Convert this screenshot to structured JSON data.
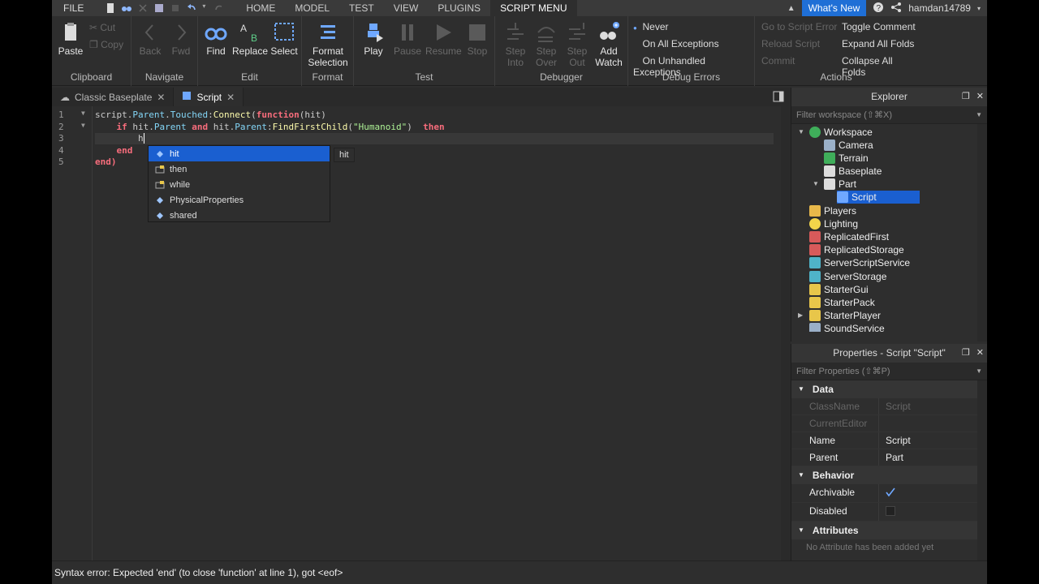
{
  "menubar": {
    "file": "FILE",
    "tabs": [
      "HOME",
      "MODEL",
      "TEST",
      "VIEW",
      "PLUGINS",
      "SCRIPT MENU"
    ],
    "whats_new": "What's New",
    "username": "hamdan14789"
  },
  "ribbon": {
    "clipboard": {
      "label": "Clipboard",
      "paste": "Paste",
      "cut": "Cut",
      "copy": "Copy"
    },
    "navigate": {
      "label": "Navigate",
      "back": "Back",
      "fwd": "Fwd"
    },
    "edit": {
      "label": "Edit",
      "find": "Find",
      "replace": "Replace",
      "select": "Select"
    },
    "format": {
      "label": "Format",
      "format_selection_line1": "Format",
      "format_selection_line2": "Selection"
    },
    "test": {
      "label": "Test",
      "play": "Play",
      "pause": "Pause",
      "resume": "Resume",
      "stop": "Stop"
    },
    "debugger": {
      "label": "Debugger",
      "step_into_1": "Step",
      "step_into_2": "Into",
      "step_over_1": "Step",
      "step_over_2": "Over",
      "step_out_1": "Step",
      "step_out_2": "Out",
      "add_watch_1": "Add",
      "add_watch_2": "Watch"
    },
    "debug_errors": {
      "label": "Debug Errors",
      "never": "Never",
      "all": "On All Exceptions",
      "unhandled": "On Unhandled Exceptions"
    },
    "actions": {
      "label": "Actions",
      "goto_error": "Go to Script Error",
      "reload": "Reload Script",
      "commit": "Commit",
      "toggle_comment": "Toggle Comment",
      "expand_folds": "Expand All Folds",
      "collapse_folds": "Collapse All Folds"
    }
  },
  "doctabs": [
    {
      "label": "Classic Baseplate"
    },
    {
      "label": "Script"
    }
  ],
  "editor": {
    "line_numbers": [
      "1",
      "2",
      "3",
      "4",
      "5"
    ],
    "line1": {
      "a": "script",
      "b": ".",
      "c": "Parent",
      "d": ".",
      "e": "Touched",
      "f": ":",
      "g": "Connect",
      "h": "(",
      "i": "function",
      "j": "(hit)"
    },
    "line2": {
      "a": "if",
      "b": " hit.",
      "c": "Parent",
      "d": " ",
      "e": "and",
      "f": " hit.",
      "g": "Parent",
      "h": ":",
      "i": "FindFirstChild",
      "j": "(",
      "k": "\"Humanoid\"",
      "l": ")  ",
      "m": "then"
    },
    "line3": "h",
    "line4": "end",
    "line5": "end)"
  },
  "autocomplete": {
    "items": [
      "hit",
      "then",
      "while",
      "PhysicalProperties",
      "shared"
    ],
    "tooltip": "hit"
  },
  "status": "Syntax error: Expected 'end' (to close 'function' at line 1), got <eof>",
  "explorer": {
    "title": "Explorer",
    "filter_placeholder": "Filter workspace (⇧⌘X)",
    "items": [
      "Workspace",
      "Camera",
      "Terrain",
      "Baseplate",
      "Part",
      "Script",
      "Players",
      "Lighting",
      "ReplicatedFirst",
      "ReplicatedStorage",
      "ServerScriptService",
      "ServerStorage",
      "StarterGui",
      "StarterPack",
      "StarterPlayer",
      "SoundService"
    ]
  },
  "properties": {
    "title": "Properties - Script \"Script\"",
    "filter_placeholder": "Filter Properties (⇧⌘P)",
    "data_section": "Data",
    "rows_data": [
      {
        "name": "ClassName",
        "value": "Script"
      },
      {
        "name": "CurrentEditor",
        "value": ""
      },
      {
        "name": "Name",
        "value": "Script"
      },
      {
        "name": "Parent",
        "value": "Part"
      }
    ],
    "behavior_section": "Behavior",
    "archivable": "Archivable",
    "disabled": "Disabled",
    "attributes_section": "Attributes",
    "no_attributes": "No Attribute has been added yet"
  }
}
